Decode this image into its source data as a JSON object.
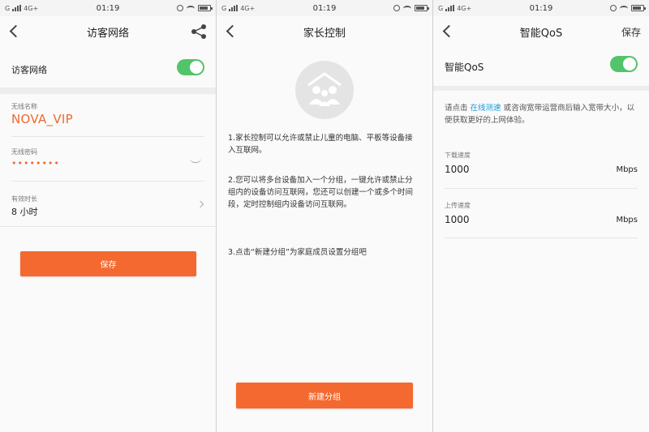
{
  "status": {
    "carrier": "G",
    "network": "4G+",
    "time": "01:19"
  },
  "screen1": {
    "title": "访客网络",
    "back_icon": "back-arrow-icon",
    "share_icon": "share-icon",
    "guest_toggle_label": "访客网络",
    "guest_toggle_on": true,
    "ssid_label": "无线名称",
    "ssid_value": "NOVA_VIP",
    "password_label": "无线密码",
    "password_value": "••••••••",
    "duration_label": "有效时长",
    "duration_value": "8 小时",
    "save_button": "保存"
  },
  "screen2": {
    "title": "家长控制",
    "illustration_icon": "family-group-icon",
    "instruction_1": "1.家长控制可以允许或禁止儿童的电脑、平板等设备接入互联网。",
    "instruction_2": "2.您可以将多台设备加入一个分组，一键允许或禁止分组内的设备访问互联网，您还可以创建一个或多个时间段，定时控制组内设备访问互联网。",
    "instruction_3": "3.点击“新建分组”为家庭成员设置分组吧",
    "new_group_button": "新建分组"
  },
  "screen3": {
    "title": "智能QoS",
    "save_label": "保存",
    "qos_toggle_label": "智能QoS",
    "qos_toggle_on": true,
    "hint_prefix": "请点击 ",
    "hint_link": "在线测速",
    "hint_suffix": " 或咨询宽带运营商后输入宽带大小，以便获取更好的上网体验。",
    "download_label": "下载速度",
    "download_value": "1000",
    "download_unit": "Mbps",
    "upload_label": "上传速度",
    "upload_value": "1000",
    "upload_unit": "Mbps"
  },
  "colors": {
    "accent_orange": "#f4692f",
    "toggle_green": "#52c46b",
    "link_blue": "#1a9bd7"
  }
}
